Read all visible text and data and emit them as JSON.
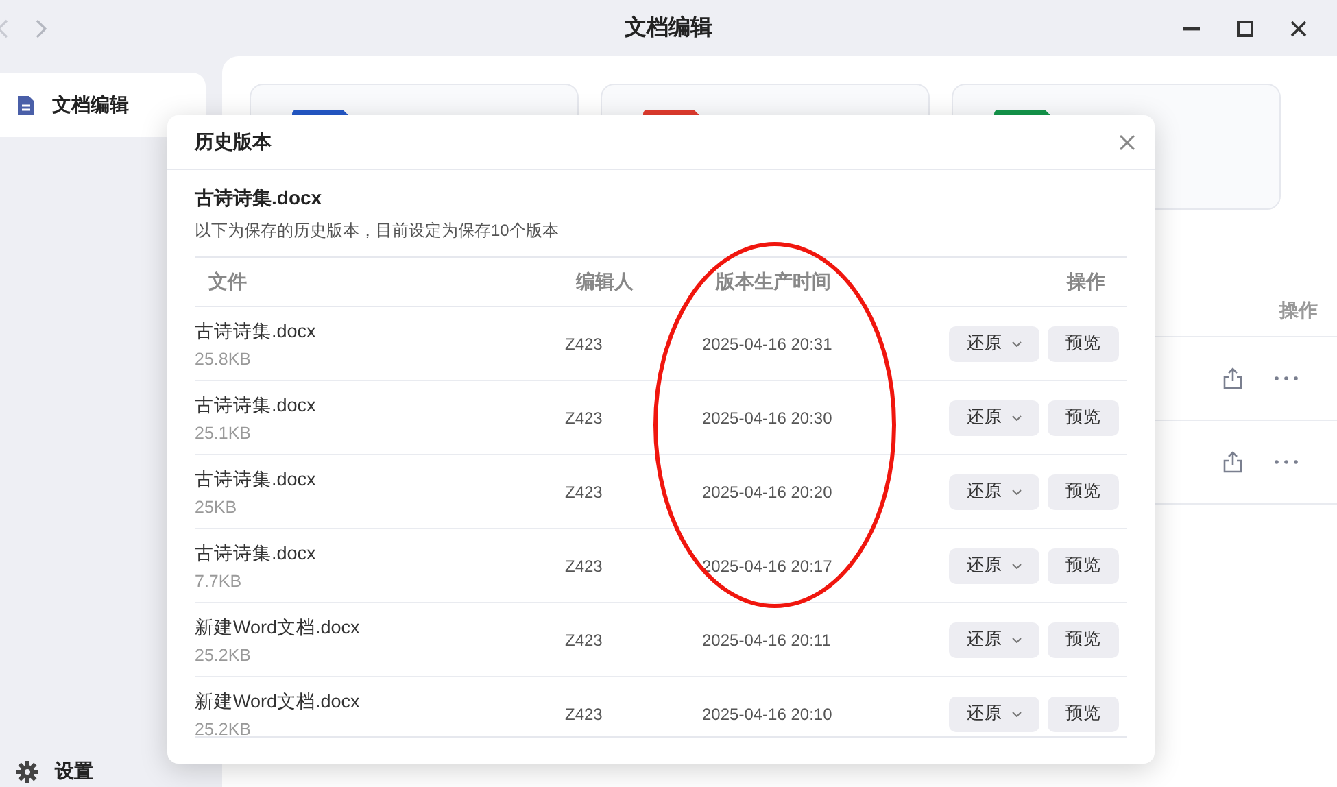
{
  "window": {
    "title": "文档编辑"
  },
  "sidebar": {
    "items": [
      {
        "label": "文档编辑",
        "selected": true
      }
    ],
    "footer": {
      "label": "设置"
    }
  },
  "main": {
    "cards": [
      {
        "color": "#2459c9"
      },
      {
        "color": "#e23b2e"
      },
      {
        "color": "#14974b"
      }
    ],
    "table": {
      "columns": [
        "操作"
      ],
      "rows": [
        {
          "kind": "file"
        },
        {
          "kind": "file"
        }
      ]
    }
  },
  "dialog": {
    "title": "历史版本",
    "file_name": "古诗诗集.docx",
    "description": "以下为保存的历史版本，目前设定为保存10个版本",
    "columns": [
      "文件",
      "编辑人",
      "版本生产时间",
      "操作"
    ],
    "rows": [
      {
        "name": "古诗诗集.docx",
        "size": "25.8KB",
        "editor": "Z423",
        "time": "2025-04-16 20:31",
        "restore": "还原",
        "preview": "预览"
      },
      {
        "name": "古诗诗集.docx",
        "size": "25.1KB",
        "editor": "Z423",
        "time": "2025-04-16 20:30",
        "restore": "还原",
        "preview": "预览"
      },
      {
        "name": "古诗诗集.docx",
        "size": "25KB",
        "editor": "Z423",
        "time": "2025-04-16 20:20",
        "restore": "还原",
        "preview": "预览"
      },
      {
        "name": "古诗诗集.docx",
        "size": "7.7KB",
        "editor": "Z423",
        "time": "2025-04-16 20:17",
        "restore": "还原",
        "preview": "预览"
      },
      {
        "name": "新建Word文档.docx",
        "size": "25.2KB",
        "editor": "Z423",
        "time": "2025-04-16 20:11",
        "restore": "还原",
        "preview": "预览"
      },
      {
        "name": "新建Word文档.docx",
        "size": "25.2KB",
        "editor": "Z423",
        "time": "2025-04-16 20:10",
        "restore": "还原",
        "preview": "预览"
      }
    ]
  }
}
